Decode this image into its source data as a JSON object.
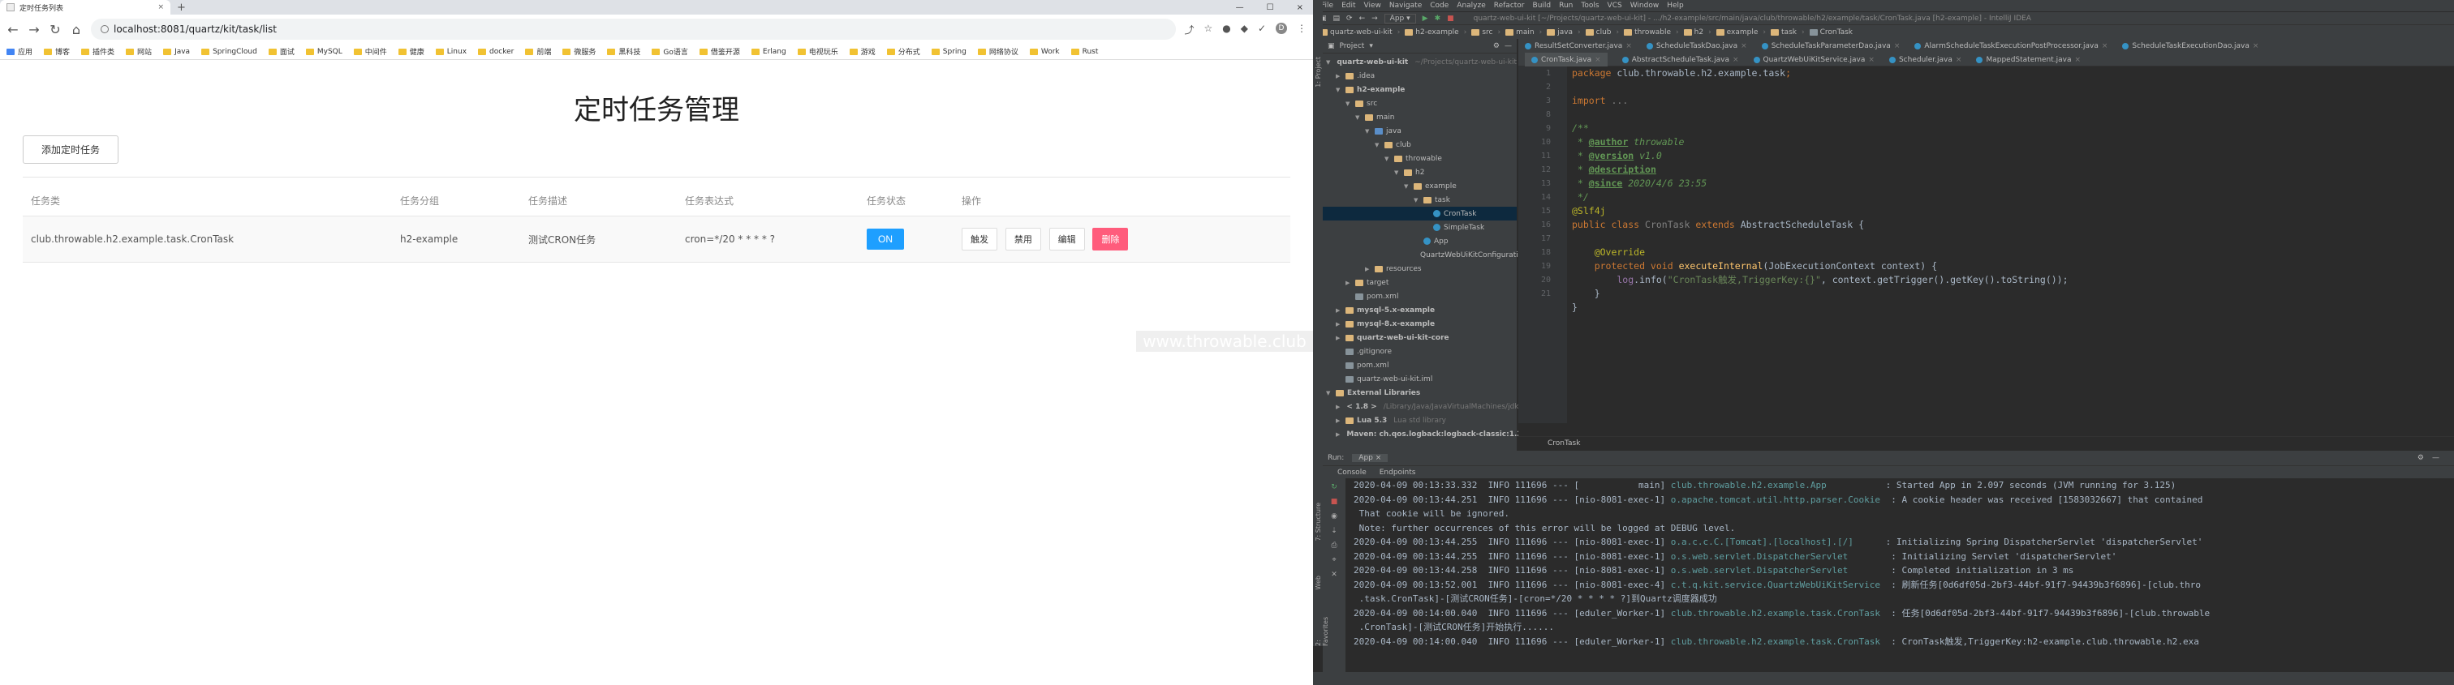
{
  "browser": {
    "tab_title": "定时任务列表",
    "tab_close": "×",
    "new_tab": "+",
    "window_controls": [
      "—",
      "☐",
      "×"
    ],
    "url": "localhost:8081/quartz/kit/task/list",
    "nav_icons": [
      "←",
      "→",
      "↻",
      "⌂"
    ],
    "ext_icons": [
      "⤴",
      "☆",
      "●",
      "◆",
      "✓",
      "D",
      "⋮"
    ],
    "bookmarks": [
      "应用",
      "博客",
      "插件类",
      "网站",
      "Java",
      "SpringCloud",
      "面试",
      "MySQL",
      "中间件",
      "健康",
      "Linux",
      "docker",
      "前端",
      "微服务",
      "黑科技",
      "Go语言",
      "借鉴开源",
      "Erlang",
      "电视玩乐",
      "游戏",
      "分布式",
      "Spring",
      "网络协议",
      "Work",
      "Rust"
    ]
  },
  "page": {
    "title": "定时任务管理",
    "add_button": "添加定时任务",
    "columns": [
      "任务类",
      "任务分组",
      "任务描述",
      "任务表达式",
      "任务状态",
      "操作"
    ],
    "rows": [
      {
        "task_class": "club.throwable.h2.example.task.CronTask",
        "group": "h2-example",
        "description": "测试CRON任务",
        "expression": "cron=*/20 * * * * ?",
        "status": "ON",
        "actions": [
          "触发",
          "禁用",
          "编辑",
          "删除"
        ]
      }
    ],
    "watermark": "www.throwable.club"
  },
  "ide": {
    "menus": [
      "File",
      "Edit",
      "View",
      "Navigate",
      "Code",
      "Analyze",
      "Refactor",
      "Build",
      "Run",
      "Tools",
      "VCS",
      "Window",
      "Help"
    ],
    "window_title": "quartz-web-ui-kit [~/Projects/quartz-web-ui-kit] - .../h2-example/src/main/java/club/throwable/h2/example/task/CronTask.java [h2-example] - IntelliJ IDEA",
    "toolbar_config": "App",
    "breadcrumbs": [
      "quartz-web-ui-kit",
      "h2-example",
      "src",
      "main",
      "java",
      "club",
      "throwable",
      "h2",
      "example",
      "task",
      "CronTask"
    ],
    "project_header": "Project",
    "tree": [
      {
        "label": "quartz-web-ui-kit",
        "extra": "~/Projects/quartz-web-ui-kit",
        "depth": 0,
        "kind": "folder",
        "open": true
      },
      {
        "label": ".idea",
        "depth": 1,
        "kind": "folder",
        "open": false
      },
      {
        "label": "h2-example",
        "depth": 1,
        "kind": "folder",
        "open": true
      },
      {
        "label": "src",
        "depth": 2,
        "kind": "folder",
        "open": true
      },
      {
        "label": "main",
        "depth": 3,
        "kind": "folder",
        "open": true
      },
      {
        "label": "java",
        "depth": 4,
        "kind": "src",
        "open": true
      },
      {
        "label": "club",
        "depth": 5,
        "kind": "folder",
        "open": true
      },
      {
        "label": "throwable",
        "depth": 6,
        "kind": "folder",
        "open": true
      },
      {
        "label": "h2",
        "depth": 7,
        "kind": "folder",
        "open": true
      },
      {
        "label": "example",
        "depth": 8,
        "kind": "folder",
        "open": true
      },
      {
        "label": "task",
        "depth": 9,
        "kind": "folder",
        "open": true
      },
      {
        "label": "CronTask",
        "depth": 10,
        "kind": "class",
        "selected": true
      },
      {
        "label": "SimpleTask",
        "depth": 10,
        "kind": "class"
      },
      {
        "label": "App",
        "depth": 9,
        "kind": "class"
      },
      {
        "label": "QuartzWebUiKitConfiguration",
        "depth": 9,
        "kind": "class"
      },
      {
        "label": "resources",
        "depth": 4,
        "kind": "folder",
        "open": false
      },
      {
        "label": "target",
        "depth": 2,
        "kind": "folder",
        "open": false
      },
      {
        "label": "pom.xml",
        "depth": 2,
        "kind": "file"
      },
      {
        "label": "mysql-5.x-example",
        "depth": 1,
        "kind": "folder",
        "open": false
      },
      {
        "label": "mysql-8.x-example",
        "depth": 1,
        "kind": "folder",
        "open": false
      },
      {
        "label": "quartz-web-ui-kit-core",
        "depth": 1,
        "kind": "folder",
        "open": false
      },
      {
        "label": ".gitignore",
        "depth": 1,
        "kind": "file"
      },
      {
        "label": "pom.xml",
        "depth": 1,
        "kind": "file"
      },
      {
        "label": "quartz-web-ui-kit.iml",
        "depth": 1,
        "kind": "file"
      },
      {
        "label": "External Libraries",
        "depth": 0,
        "kind": "folder",
        "open": true
      },
      {
        "label": "< 1.8 >",
        "extra": "/Library/Java/JavaVirtualMachines/jdk1.8.0_212",
        "depth": 1,
        "kind": "folder",
        "open": false
      },
      {
        "label": "Lua 5.3",
        "extra": "Lua std library",
        "depth": 1,
        "kind": "folder",
        "open": false
      },
      {
        "label": "Maven: ch.qos.logback:logback-classic:1.2.3",
        "depth": 1,
        "kind": "folder",
        "open": false
      }
    ],
    "editor_tabs_row1": [
      "ResultSetConverter.java",
      "ScheduleTaskDao.java",
      "ScheduleTaskParameterDao.java",
      "AlarmScheduleTaskExecutionPostProcessor.java",
      "ScheduleTaskExecutionDao.java"
    ],
    "editor_tabs_row2": [
      "CronTask.java",
      "AbstractScheduleTask.java",
      "QuartzWebUiKitService.java",
      "Scheduler.java",
      "MappedStatement.java"
    ],
    "line_numbers": [
      "1",
      "2",
      "3",
      "8",
      "9",
      "10",
      "11",
      "12",
      "13",
      "14",
      "15",
      "16",
      "17",
      "18",
      "19",
      "20",
      "21"
    ],
    "code_lines": [
      [
        {
          "t": "package ",
          "c": "kw"
        },
        {
          "t": "club.throwable.h2.example.task",
          "c": "cls"
        },
        {
          "t": ";",
          "c": "kw"
        }
      ],
      [],
      [
        {
          "t": "import ",
          "c": "kw"
        },
        {
          "t": "...",
          "c": "grey"
        }
      ],
      [],
      [
        {
          "t": "/**",
          "c": "cmt"
        }
      ],
      [
        {
          "t": " * ",
          "c": "cmt"
        },
        {
          "t": "@author",
          "c": "tag"
        },
        {
          "t": " throwable",
          "c": "cmt"
        }
      ],
      [
        {
          "t": " * ",
          "c": "cmt"
        },
        {
          "t": "@version",
          "c": "tag"
        },
        {
          "t": " v1.0",
          "c": "cmt"
        }
      ],
      [
        {
          "t": " * ",
          "c": "cmt"
        },
        {
          "t": "@description",
          "c": "tag"
        }
      ],
      [
        {
          "t": " * ",
          "c": "cmt"
        },
        {
          "t": "@since",
          "c": "tag"
        },
        {
          "t": " 2020/4/6 23:55",
          "c": "cmt"
        }
      ],
      [
        {
          "t": " */",
          "c": "cmt"
        }
      ],
      [
        {
          "t": "@Slf4j",
          "c": "ann"
        }
      ],
      [
        {
          "t": "public class ",
          "c": "kw"
        },
        {
          "t": "CronTask ",
          "c": "grey"
        },
        {
          "t": "extends ",
          "c": "kw"
        },
        {
          "t": "AbstractScheduleTask",
          "c": "cls"
        },
        {
          "t": " {",
          "c": "cls"
        }
      ],
      [],
      [
        {
          "t": "    @Override",
          "c": "ann"
        }
      ],
      [
        {
          "t": "    protected void ",
          "c": "kw"
        },
        {
          "t": "executeInternal",
          "c": "fn"
        },
        {
          "t": "(JobExecutionContext context) {",
          "c": "cls"
        }
      ],
      [
        {
          "t": "        log",
          "c": "field"
        },
        {
          "t": ".info(",
          "c": "cls"
        },
        {
          "t": "\"CronTask触发,TriggerKey:{}\"",
          "c": "str"
        },
        {
          "t": ", context.getTrigger().getKey().toString());",
          "c": "cls"
        }
      ],
      [
        {
          "t": "    }",
          "c": "cls"
        }
      ],
      [
        {
          "t": "}",
          "c": "cls"
        }
      ]
    ],
    "editor_footer": "CronTask",
    "run_label": "Run:",
    "run_config": "App",
    "run_tabs": [
      "Console",
      "Endpoints"
    ],
    "logs": [
      {
        "p": "2020-04-09 00:13:33.332  INFO 111696 --- [           main] ",
        "l": "club.throwable.h2.example.App          ",
        "m": " : Started App in 2.097 seconds (JVM running for 3.125)"
      },
      {
        "p": "2020-04-09 00:13:44.251  INFO 111696 --- [nio-8081-exec-1] ",
        "l": "o.apache.tomcat.util.http.parser.Cookie ",
        "m": " : A cookie header was received [1583032667] that contained"
      },
      {
        "p": " That cookie will be ignored.",
        "l": "",
        "m": ""
      },
      {
        "p": " Note: further occurrences of this error will be logged at DEBUG level.",
        "l": "",
        "m": ""
      },
      {
        "p": "2020-04-09 00:13:44.255  INFO 111696 --- [nio-8081-exec-1] ",
        "l": "o.a.c.c.C.[Tomcat].[localhost].[/]     ",
        "m": " : Initializing Spring DispatcherServlet 'dispatcherServlet'"
      },
      {
        "p": "2020-04-09 00:13:44.255  INFO 111696 --- [nio-8081-exec-1] ",
        "l": "o.s.web.servlet.DispatcherServlet       ",
        "m": " : Initializing Servlet 'dispatcherServlet'"
      },
      {
        "p": "2020-04-09 00:13:44.258  INFO 111696 --- [nio-8081-exec-1] ",
        "l": "o.s.web.servlet.DispatcherServlet       ",
        "m": " : Completed initialization in 3 ms"
      },
      {
        "p": "2020-04-09 00:13:52.001  INFO 111696 --- [nio-8081-exec-4] ",
        "l": "c.t.q.kit.service.QuartzWebUiKitService ",
        "m": " : 刷新任务[0d6df05d-2bf3-44bf-91f7-94439b3f6896]-[club.thro"
      },
      {
        "p": " .task.CronTask]-[测试CRON任务]-[cron=*/20 * * * * ?]到Quartz调度器成功",
        "l": "",
        "m": ""
      },
      {
        "p": "2020-04-09 00:14:00.040  INFO 111696 --- [eduler_Worker-1] ",
        "l": "club.throwable.h2.example.task.CronTask ",
        "m": " : 任务[0d6df05d-2bf3-44bf-91f7-94439b3f6896]-[club.throwable"
      },
      {
        "p": " .CronTask]-[测试CRON任务]开始执行......",
        "l": "",
        "m": ""
      },
      {
        "p": "2020-04-09 00:14:00.040  INFO 111696 --- [eduler_Worker-1] ",
        "l": "club.throwable.h2.example.task.CronTask ",
        "m": " : CronTask触发,TriggerKey:h2-example.club.throwable.h2.exa"
      }
    ],
    "side_labels": [
      "1: Project",
      "2: Favorites",
      "Web",
      "7: Structure"
    ]
  }
}
